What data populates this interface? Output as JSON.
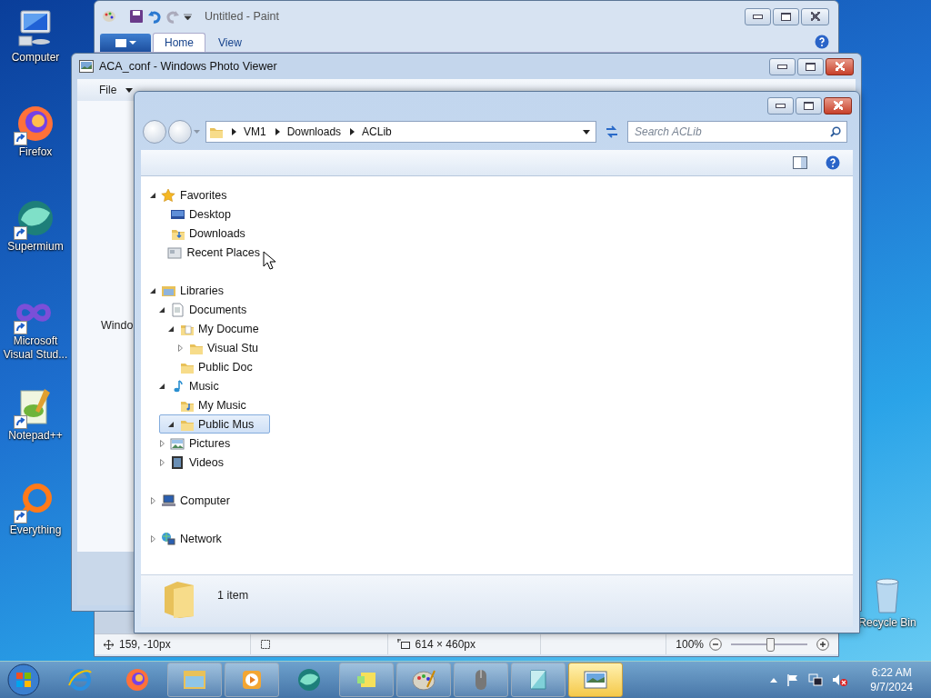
{
  "desktop": {
    "icons": [
      {
        "label": "Computer",
        "kind": "computer",
        "shortcut": false
      },
      {
        "label": "Firefox",
        "kind": "firefox",
        "shortcut": true
      },
      {
        "label": "Supermium",
        "kind": "supermium",
        "shortcut": true
      },
      {
        "label": "Microsoft Visual Stud...",
        "kind": "vstudio",
        "shortcut": true
      },
      {
        "label": "Notepad++",
        "kind": "notepadpp",
        "shortcut": true
      },
      {
        "label": "Everything",
        "kind": "everything",
        "shortcut": true
      }
    ],
    "recycle_bin": {
      "label": "Recycle Bin"
    }
  },
  "paint": {
    "title": "Untitled - Paint",
    "tabs": [
      {
        "label": "Home",
        "selected": true
      },
      {
        "label": "View",
        "selected": false
      }
    ],
    "status_bar": {
      "cursor_position": "159, -10px",
      "image_size": "614 × 460px",
      "zoom": "100%",
      "zoom_slider": {
        "level": 0.5
      }
    }
  },
  "photo_viewer": {
    "title": "ACA_conf - Windows Photo Viewer",
    "menu": [
      {
        "label": "File",
        "dropdown": true
      }
    ],
    "message": "Windo"
  },
  "explorer": {
    "breadcrumb": [
      "VM1",
      "Downloads",
      "ACLib"
    ],
    "search": {
      "placeholder": "Search ACLib"
    },
    "nav_tree": [
      {
        "label": "Favorites",
        "kind": "star",
        "expanded": true,
        "selected": false,
        "children": [
          {
            "label": "Desktop",
            "kind": "desktop",
            "selected": false
          },
          {
            "label": "Downloads",
            "kind": "downloads",
            "selected": false
          },
          {
            "label": "Recent Places",
            "kind": "recent",
            "selected": false
          }
        ]
      },
      {
        "label": "Libraries",
        "kind": "library",
        "expanded": true,
        "selected": false,
        "children": [
          {
            "label": "Documents",
            "kind": "document",
            "expanded": true,
            "selected": false,
            "children": [
              {
                "label": "My Docume",
                "kind": "folder-doc",
                "expanded": true,
                "selected": false,
                "children": [
                  {
                    "label": "Visual Stu",
                    "kind": "folder",
                    "expanded": false,
                    "selected": false
                  }
                ]
              },
              {
                "label": "Public Doc",
                "kind": "folder",
                "selected": false
              }
            ]
          },
          {
            "label": "Music",
            "kind": "music",
            "expanded": true,
            "selected": false,
            "children": [
              {
                "label": "My Music",
                "kind": "folder-music",
                "selected": false
              },
              {
                "label": "Public Mus",
                "kind": "folder",
                "expanded": true,
                "selected": true
              }
            ]
          },
          {
            "label": "Pictures",
            "kind": "pictures",
            "expanded": false,
            "selected": false
          },
          {
            "label": "Videos",
            "kind": "videos",
            "expanded": false,
            "selected": false
          }
        ]
      },
      {
        "label": "Computer",
        "kind": "computer",
        "expanded": false,
        "selected": false
      },
      {
        "label": "Network",
        "kind": "network",
        "expanded": false,
        "selected": false
      }
    ],
    "status": {
      "item_count": "1 item"
    }
  },
  "taskbar": {
    "apps": [
      {
        "kind": "ie",
        "running": false,
        "selected": false
      },
      {
        "kind": "firefox",
        "running": false,
        "selected": false
      },
      {
        "kind": "explorer",
        "running": true,
        "selected": false
      },
      {
        "kind": "media",
        "running": true,
        "selected": false
      },
      {
        "kind": "supermium",
        "running": false,
        "selected": false
      },
      {
        "kind": "sticky",
        "running": true,
        "selected": false
      },
      {
        "kind": "paint",
        "running": true,
        "selected": false
      },
      {
        "kind": "mouse",
        "running": true,
        "selected": false
      },
      {
        "kind": "notepad",
        "running": true,
        "selected": false
      },
      {
        "kind": "photo",
        "running": true,
        "selected": true
      }
    ],
    "clock": {
      "time": "6:22 AM",
      "date": "9/7/2024"
    }
  }
}
